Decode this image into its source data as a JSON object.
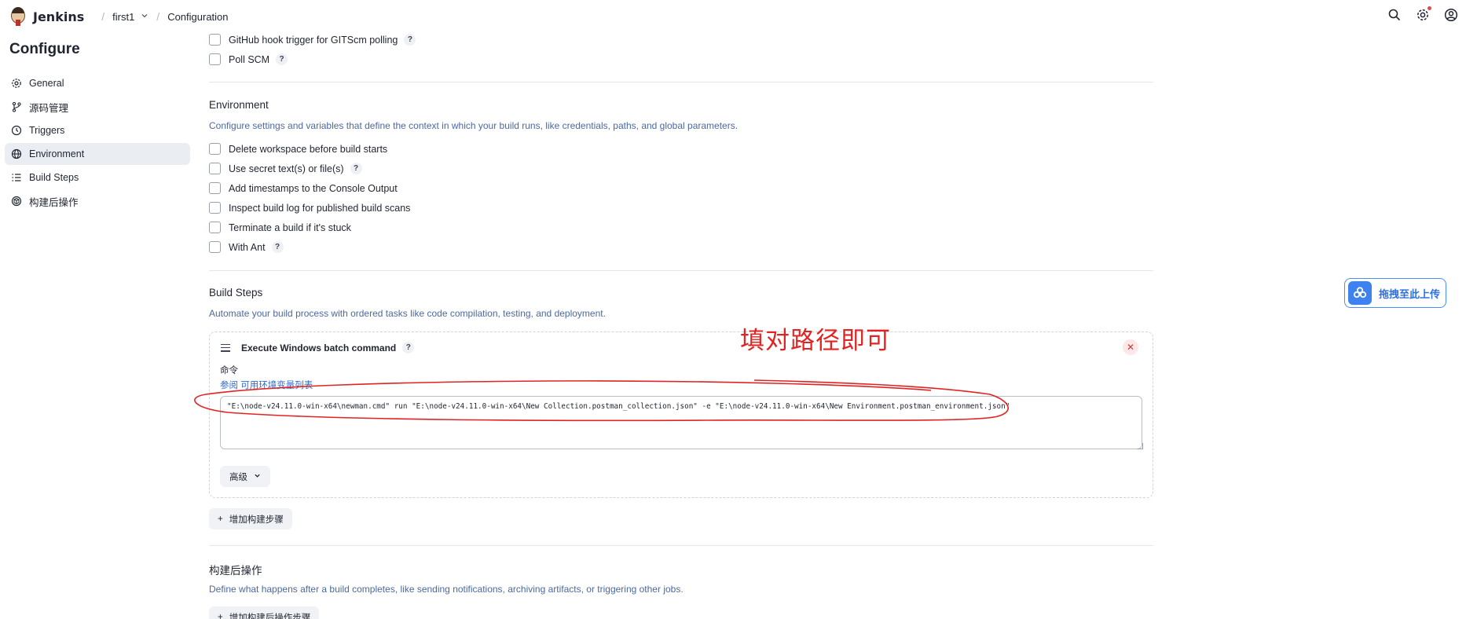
{
  "header": {
    "brand": "Jenkins",
    "breadcrumbs": [
      "first1",
      "Configuration"
    ]
  },
  "page_title": "Configure",
  "sidebar": {
    "items": [
      {
        "label": "General",
        "icon": "gear-icon"
      },
      {
        "label": "源码管理",
        "icon": "branch-icon"
      },
      {
        "label": "Triggers",
        "icon": "clock-icon"
      },
      {
        "label": "Environment",
        "icon": "globe-icon",
        "active": true
      },
      {
        "label": "Build Steps",
        "icon": "list-icon"
      },
      {
        "label": "构建后操作",
        "icon": "package-icon"
      }
    ]
  },
  "triggers": {
    "github_hook": "GitHub hook trigger for GITScm polling",
    "poll_scm": "Poll SCM"
  },
  "environment": {
    "title": "Environment",
    "description": "Configure settings and variables that define the context in which your build runs, like credentials, paths, and global parameters.",
    "options": [
      "Delete workspace before build starts",
      "Use secret text(s) or file(s)",
      "Add timestamps to the Console Output",
      "Inspect build log for published build scans",
      "Terminate a build if it's stuck",
      "With Ant"
    ]
  },
  "build_steps": {
    "title": "Build Steps",
    "description": "Automate your build process with ordered tasks like code compilation, testing, and deployment.",
    "step": {
      "title": "Execute Windows batch command",
      "command_label": "命令",
      "env_link": "参阅 可用环境变量列表",
      "command_value": "\"E:\\node-v24.11.0-win-x64\\newman.cmd\" run \"E:\\node-v24.11.0-win-x64\\New Collection.postman_collection.json\" -e \"E:\\node-v24.11.0-win-x64\\New Environment.postman_environment.json\"",
      "advanced_label": "高级"
    },
    "add_step_label": "增加构建步骤"
  },
  "post_build": {
    "title": "构建后操作",
    "description": "Define what happens after a build completes, like sending notifications, archiving artifacts, or triggering other jobs.",
    "add_label": "增加构建后操作步骤"
  },
  "annotation": {
    "text": "填对路径即可",
    "color": "#e02424"
  },
  "upload_widget": {
    "label": "拖拽至此上传"
  },
  "colors": {
    "accent_link": "#2d6bd6",
    "desc_text": "#4b6a9e",
    "active_bg": "#eaedf2"
  }
}
